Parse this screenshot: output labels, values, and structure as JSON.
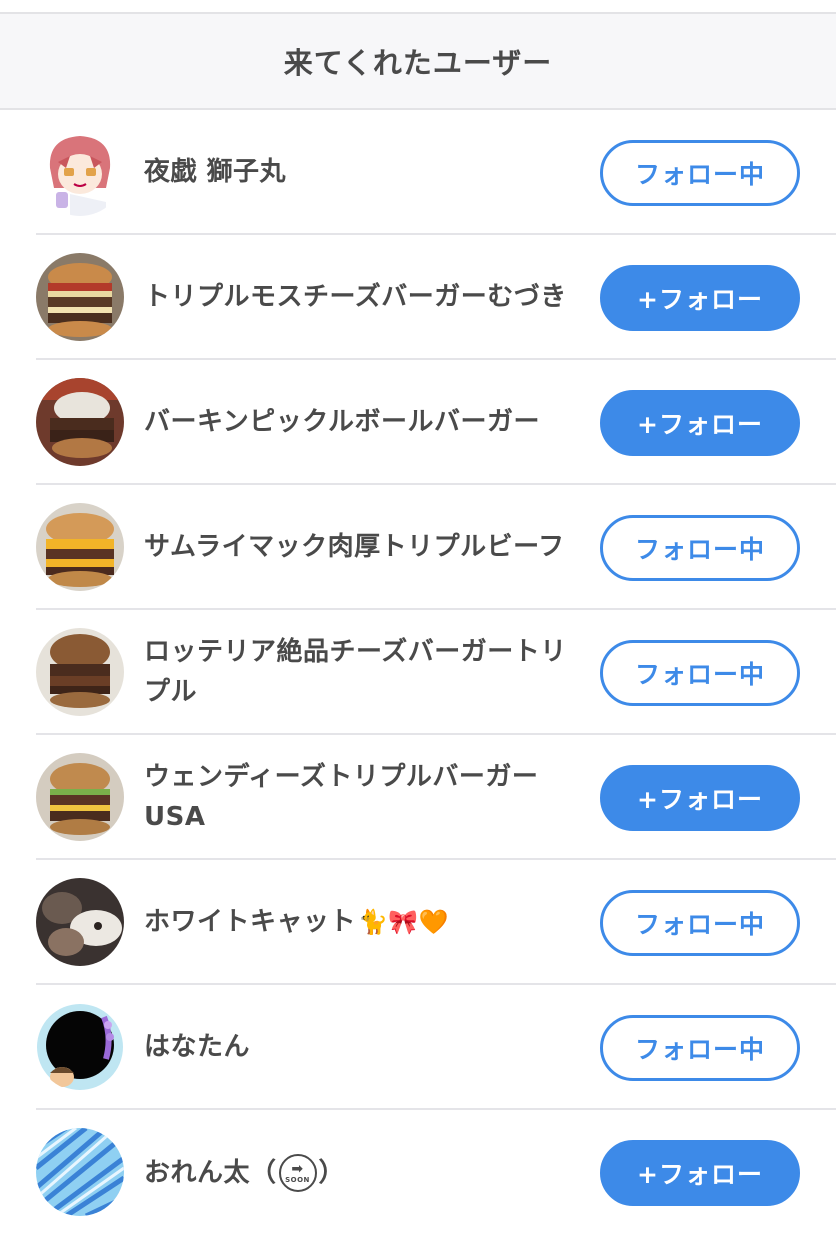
{
  "header": {
    "title": "来てくれたユーザー"
  },
  "users": [
    {
      "name": "夜戯 獅子丸",
      "button": "フォロー中",
      "state": "following",
      "avatar": "anime-girl-avatar-icon",
      "emoji": ""
    },
    {
      "name": "トリプルモスチーズバーガーむづき",
      "button": "+フォロー",
      "state": "follow",
      "avatar": "burger-avatar-icon",
      "emoji": ""
    },
    {
      "name": "バーキンピックルボールバーガー",
      "button": "+フォロー",
      "state": "follow",
      "avatar": "burger-avatar-icon",
      "emoji": ""
    },
    {
      "name": "サムライマック肉厚トリプルビーフ",
      "button": "フォロー中",
      "state": "following",
      "avatar": "burger-avatar-icon",
      "emoji": ""
    },
    {
      "name": "ロッテリア絶品チーズバーガートリプル",
      "button": "フォロー中",
      "state": "following",
      "avatar": "burger-avatar-icon",
      "emoji": ""
    },
    {
      "name": "ウェンディーズトリプルバーガーUSA",
      "button": "+フォロー",
      "state": "follow",
      "avatar": "burger-avatar-icon",
      "emoji": ""
    },
    {
      "name": "ホワイトキャット",
      "button": "フォロー中",
      "state": "following",
      "avatar": "cat-photo-avatar-icon",
      "emoji": "🐈🎀🧡"
    },
    {
      "name": "はなたん",
      "button": "フォロー中",
      "state": "following",
      "avatar": "flower-frame-avatar-icon",
      "emoji": ""
    },
    {
      "name": "おれん太（",
      "name_suffix": "）",
      "soon_icon": "SOON",
      "button": "+フォロー",
      "state": "follow",
      "avatar": "blue-pattern-avatar-icon",
      "emoji": ""
    }
  ],
  "colors": {
    "accent": "#3d8ae8",
    "text": "#4a4a4a",
    "divider": "#e4e4e8",
    "header_bg": "#f7f7f9"
  }
}
